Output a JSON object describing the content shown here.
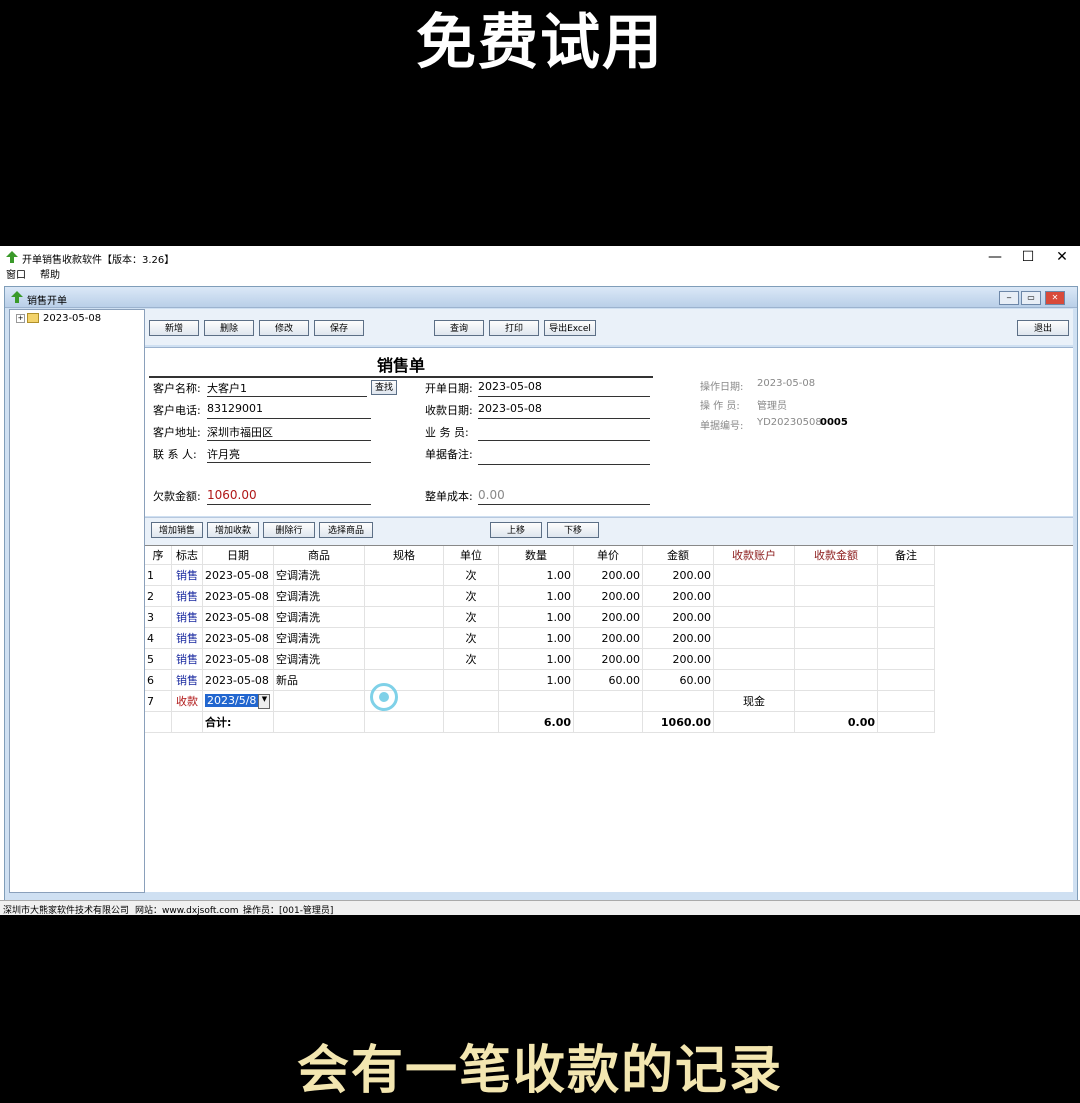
{
  "captions": {
    "top": "免费试用",
    "bottom": "会有一笔收款的记录"
  },
  "window": {
    "title": "开单销售收款软件【版本：3.26】",
    "min": "—",
    "max": "☐",
    "close": "✕"
  },
  "menu": [
    "窗口",
    "帮助"
  ],
  "child": {
    "title": "销售开单"
  },
  "tree": {
    "node": "2023-05-08"
  },
  "toolbar": {
    "new": "新增",
    "delete": "删除",
    "edit": "修改",
    "save": "保存",
    "query": "查询",
    "print": "打印",
    "export": "导出Excel",
    "exit": "退出"
  },
  "form": {
    "title": "销售单",
    "customer_name_label": "客户名称:",
    "customer_name": "大客户1",
    "find": "查找",
    "phone_label": "客户电话:",
    "phone": "83129001",
    "address_label": "客户地址:",
    "address": "深圳市福田区",
    "contact_label": "联 系 人:",
    "contact": "许月亮",
    "debt_label": "欠款金额:",
    "debt": "1060.00",
    "open_date_label": "开单日期:",
    "open_date": "2023-05-08",
    "pay_date_label": "收款日期:",
    "pay_date": "2023-05-08",
    "salesman_label": "业 务 员:",
    "salesman": "",
    "note_label": "单据备注:",
    "note": "",
    "cost_label": "整单成本:",
    "cost": "0.00",
    "op_date_label": "操作日期:",
    "op_date": "2023-05-08",
    "operator_label": "操 作 员:",
    "operator": "管理员",
    "doc_no_label": "单据编号:",
    "doc_no_prefix": "YD20230508",
    "doc_no_suffix": "0005"
  },
  "toolbar2": {
    "add_sale": "增加销售",
    "add_pay": "增加收款",
    "del_row": "删除行",
    "select_goods": "选择商品",
    "up": "上移",
    "down": "下移"
  },
  "grid": {
    "headers": [
      "序",
      "标志",
      "日期",
      "商品",
      "规格",
      "单位",
      "数量",
      "单价",
      "金额",
      "收款账户",
      "收款金额",
      "备注"
    ],
    "rows": [
      [
        "1",
        "销售",
        "2023-05-08",
        "空调清洗",
        "",
        "次",
        "1.00",
        "200.00",
        "200.00",
        "",
        "",
        ""
      ],
      [
        "2",
        "销售",
        "2023-05-08",
        "空调清洗",
        "",
        "次",
        "1.00",
        "200.00",
        "200.00",
        "",
        "",
        ""
      ],
      [
        "3",
        "销售",
        "2023-05-08",
        "空调清洗",
        "",
        "次",
        "1.00",
        "200.00",
        "200.00",
        "",
        "",
        ""
      ],
      [
        "4",
        "销售",
        "2023-05-08",
        "空调清洗",
        "",
        "次",
        "1.00",
        "200.00",
        "200.00",
        "",
        "",
        ""
      ],
      [
        "5",
        "销售",
        "2023-05-08",
        "空调清洗",
        "",
        "次",
        "1.00",
        "200.00",
        "200.00",
        "",
        "",
        ""
      ],
      [
        "6",
        "销售",
        "2023-05-08",
        "新品",
        "",
        "",
        "1.00",
        "60.00",
        "60.00",
        "",
        "",
        ""
      ]
    ],
    "pay_row": {
      "no": "7",
      "flag": "收款",
      "date": "2023/5/8",
      "account": "现金"
    },
    "total": {
      "label": "合计:",
      "qty": "6.00",
      "amount": "1060.00",
      "pay_amount": "0.00"
    }
  },
  "status": {
    "company": "深圳市大熊家软件技术有限公司",
    "site": "网站：www.dxjsoft.com",
    "operator": "操作员：[001-管理员]"
  },
  "colors": {
    "header_red": "#8b1a1a",
    "flag_blue": "#1a2aa0",
    "pay_red": "#b01818"
  }
}
